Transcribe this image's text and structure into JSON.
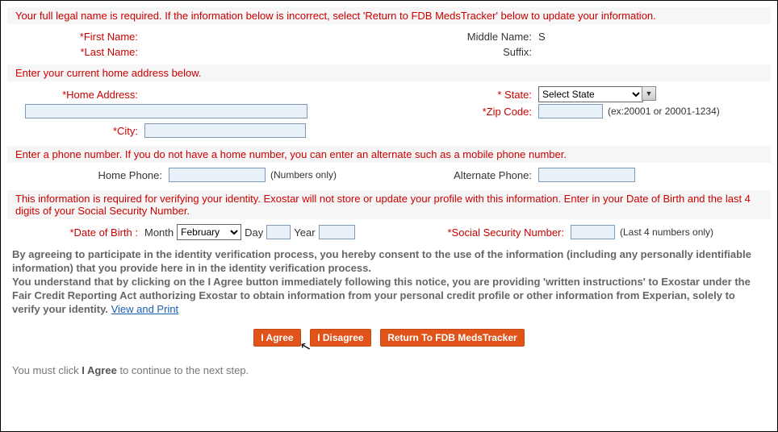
{
  "instructions": {
    "legalName": "Your full legal name is required. If the information below is incorrect, select 'Return to FDB MedsTracker' below to update your information.",
    "address": "Enter your current home address below.",
    "phone": "Enter a phone number. If you do not have a home number, you can enter an alternate such as a mobile phone number.",
    "identity": "This information is required for verifying your identity. Exostar will not store or update your profile with this information. Enter in your Date of Birth and the last 4 digits of your Social Security Number."
  },
  "labels": {
    "firstName": "*First Name:",
    "middleName": "Middle Name:",
    "lastName": "*Last Name:",
    "suffix": "Suffix:",
    "homeAddress": "*Home Address:",
    "state": "* State:",
    "city": "*City:",
    "zip": "*Zip Code:",
    "homePhone": "Home Phone:",
    "altPhone": "Alternate Phone:",
    "dob": "*Date of Birth :",
    "ssn": "*Social Security Number:"
  },
  "values": {
    "middleName": "S",
    "stateSelected": "Select State",
    "monthSelected": "February"
  },
  "hints": {
    "zip": "(ex:20001 or 20001-1234)",
    "homePhone": "(Numbers only)",
    "ssn": "(Last 4 numbers only)",
    "month": "Month",
    "day": "Day",
    "year": "Year"
  },
  "disclaimer": {
    "p1": "By agreeing to participate in the identity verification process, you hereby consent to the use of the information (including any personally identifiable information) that you provide here in in the identity verification process.",
    "p2a": "You understand that by clicking on the I Agree button immediately following this notice, you are providing 'written instructions' to Exostar under the Fair Credit Reporting Act authorizing Exostar to obtain information from your personal credit profile or other information from Experian, solely to verify your identity. ",
    "link": "View and Print"
  },
  "buttons": {
    "agree": "I Agree",
    "disagree": "I Disagree",
    "return": "Return To FDB MedsTracker"
  },
  "footnote": {
    "pre": "You must click ",
    "bold": "I Agree",
    "post": " to continue to the next step."
  }
}
